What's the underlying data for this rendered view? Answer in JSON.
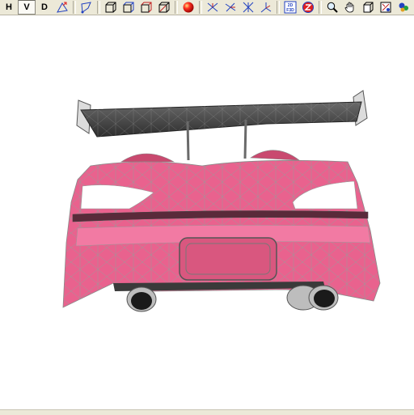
{
  "toolbar": {
    "letters": {
      "h": "H",
      "v": "V",
      "d": "D"
    },
    "icons": [
      "select-vertex-icon",
      "select-edge-icon",
      "cube-front-icon",
      "cube-side-icon",
      "cube-top-icon",
      "cube-perspective-icon",
      "render-sphere-icon",
      "axis-x-icon",
      "axis-y-icon",
      "axis-xy-icon",
      "axis-3d-icon",
      "f3d-icon",
      "z-icon",
      "zoom-icon",
      "pan-hand-icon",
      "box-icon",
      "fit-view-icon",
      "camera-icon"
    ]
  },
  "model": {
    "name": "pink-sports-car-rear",
    "body_color": "#e9628e",
    "body_light_color": "#f27aa3",
    "wireframe_color": "#9a9a9a",
    "spoiler_color": "#4a4a4a",
    "spoiler_light_color": "#cfcfcf"
  }
}
